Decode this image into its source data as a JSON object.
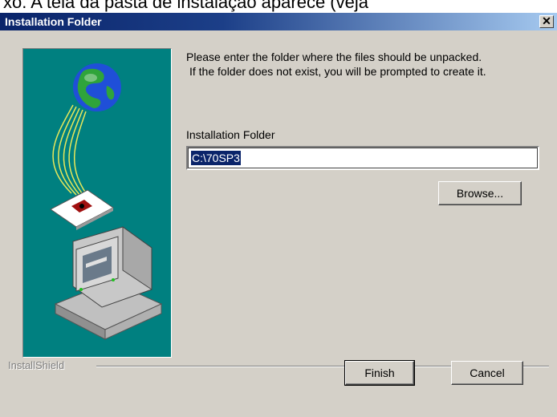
{
  "background_text": "xo. A tela da pasta de instalação aparece (veja",
  "window": {
    "title": "Installation Folder",
    "close_glyph": "✕"
  },
  "instructions": {
    "line1": "Please enter the folder where the files should be unpacked.",
    "line2": "If the folder does not exist, you will be prompted to create it."
  },
  "folder": {
    "label": "Installation Folder",
    "value": "C:\\70SP3"
  },
  "buttons": {
    "browse": "Browse...",
    "finish": "Finish",
    "cancel": "Cancel"
  },
  "brand": "InstallShield",
  "colors": {
    "art_background": "#008080",
    "title_gradient_start": "#0a246a",
    "title_gradient_end": "#a6caf0",
    "dialog_face": "#d4d0c8"
  },
  "icons": [
    "close-icon",
    "globe-icon",
    "computer-icon",
    "package-icon"
  ]
}
